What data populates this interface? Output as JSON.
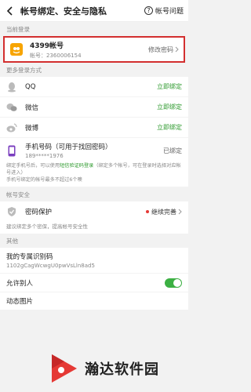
{
  "header": {
    "title": "帐号绑定、安全与隐私",
    "help_label": "帐号问题"
  },
  "current_login": {
    "section_label": "当前登录",
    "account_name": "4399帐号",
    "account_number": "帐号：2360006154",
    "change_password_label": "修改密码"
  },
  "more_login": {
    "section_label": "更多登录方式",
    "items": [
      {
        "label": "QQ",
        "action": "立即绑定"
      },
      {
        "label": "微信",
        "action": "立即绑定"
      },
      {
        "label": "微博",
        "action": "立即绑定"
      }
    ],
    "phone": {
      "label": "手机号码（可用于找回密码）",
      "number": "189*****1976",
      "status": "已绑定",
      "note_pre": "绑定手机号后，可以使用",
      "note_link": "短信验证码登录",
      "note_post": "（绑定多个帐号，可在登录时选择对应帐号进入）",
      "note_line2": "手机号绑定的帐号最多不超过6个噢"
    }
  },
  "security": {
    "section_label": "帐号安全",
    "label": "密码保护",
    "action": "继续完善",
    "note": "建议绑定多个密保，提高帐号安全性"
  },
  "other": {
    "section_label": "其他",
    "id_label": "我的专属识别码",
    "id_value": "1102gCagWcwgU0pwVsLln8ad5",
    "allow_label": "允许别人",
    "dynamic_label": "动态图片"
  },
  "watermark": {
    "text": "瀚达软件园"
  },
  "colors": {
    "green": "#2e9a2e",
    "highlight_border": "#d32f2f",
    "logo_orange": "#f7a400"
  }
}
